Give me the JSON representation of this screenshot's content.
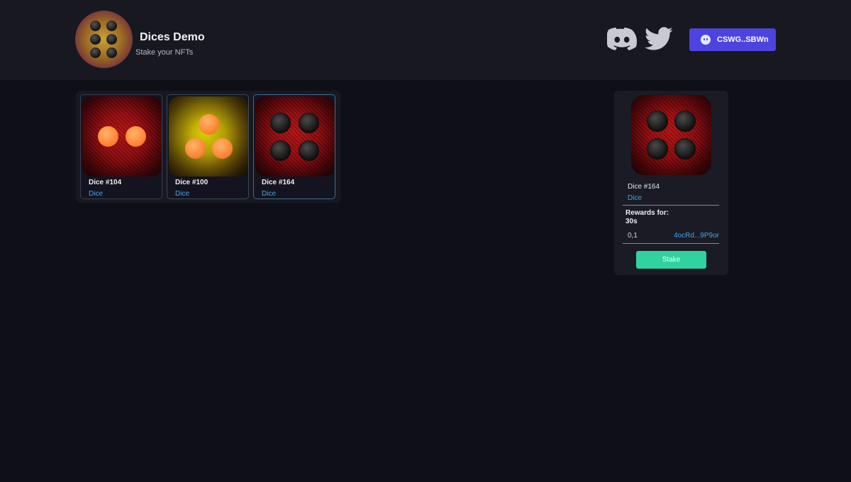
{
  "header": {
    "title": "Dices Demo",
    "subtitle": "Stake your NFTs",
    "logo_icon": "dice-logo-icon",
    "social": [
      {
        "name": "discord-icon",
        "color": "#c9c9d1"
      },
      {
        "name": "twitter-icon",
        "color": "#c9c9d1"
      }
    ],
    "wallet": {
      "label": "CSWG..SBWn",
      "icon": "ghost-wallet-icon",
      "color": "#4d44e0"
    }
  },
  "nfts": [
    {
      "name": "Dice #104",
      "collection": "Dice",
      "face": "red",
      "pips": 2,
      "pip_color": "orange",
      "selected": false
    },
    {
      "name": "Dice #100",
      "collection": "Dice",
      "face": "yellow",
      "pips": 3,
      "pip_color": "orange",
      "selected": false
    },
    {
      "name": "Dice #164",
      "collection": "Dice",
      "face": "red",
      "pips": 4,
      "pip_color": "black",
      "selected": true
    }
  ],
  "detail": {
    "name": "Dice #164",
    "collection": "Dice",
    "rewards_label": "Rewards for:",
    "rewards_period": "30s",
    "reward_value": "0,1",
    "reward_address": "4ocRd...9P9or",
    "stake_label": "Stake"
  },
  "colors": {
    "background": "#0e0f17",
    "header": "#181821",
    "link": "#4aa3e6",
    "stake": "#30d3a0",
    "card_border": "#2f3a4d",
    "card_border_selected": "#3e6d8f"
  }
}
